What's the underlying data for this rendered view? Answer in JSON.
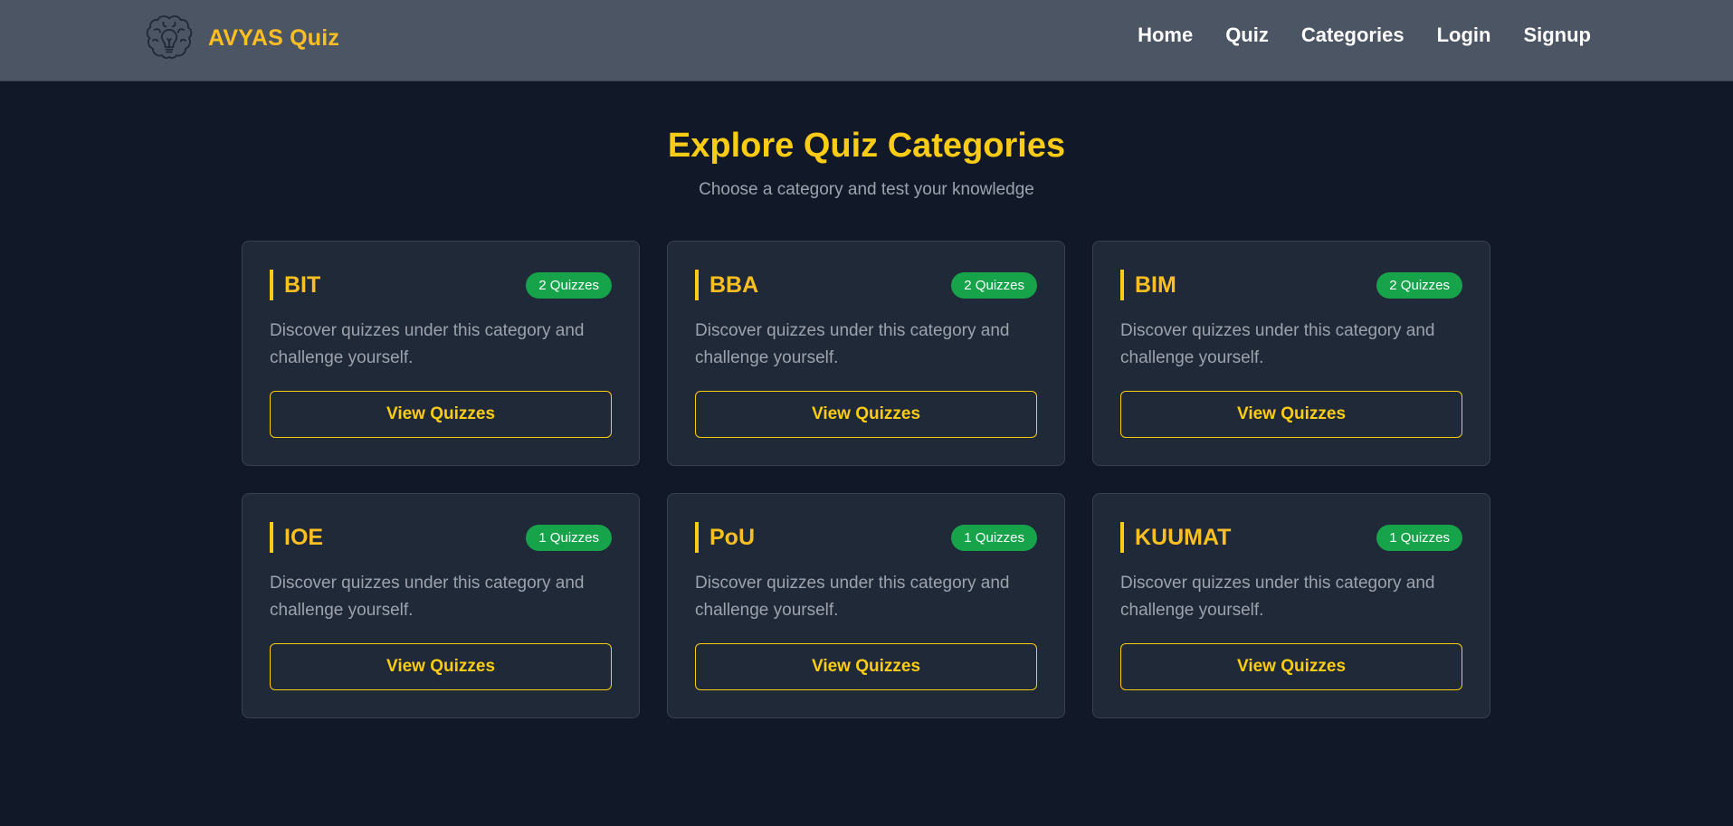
{
  "brand": {
    "name": "AVYAS Quiz",
    "logo_icon": "brain-lightbulb-icon"
  },
  "nav": {
    "links": [
      "Home",
      "Quiz",
      "Categories",
      "Login",
      "Signup"
    ]
  },
  "hero": {
    "title": "Explore Quiz Categories",
    "subtitle": "Choose a category and test your knowledge"
  },
  "categories": [
    {
      "name": "BIT",
      "badge": "2 Quizzes",
      "description": "Discover quizzes under this category and challenge yourself.",
      "button": "View Quizzes"
    },
    {
      "name": "BBA",
      "badge": "2 Quizzes",
      "description": "Discover quizzes under this category and challenge yourself.",
      "button": "View Quizzes"
    },
    {
      "name": "BIM",
      "badge": "2 Quizzes",
      "description": "Discover quizzes under this category and challenge yourself.",
      "button": "View Quizzes"
    },
    {
      "name": "IOE",
      "badge": "1 Quizzes",
      "description": "Discover quizzes under this category and challenge yourself.",
      "button": "View Quizzes"
    },
    {
      "name": "PoU",
      "badge": "1 Quizzes",
      "description": "Discover quizzes under this category and challenge yourself.",
      "button": "View Quizzes"
    },
    {
      "name": "KUUMAT",
      "badge": "1 Quizzes",
      "description": "Discover quizzes under this category and challenge yourself.",
      "button": "View Quizzes"
    }
  ],
  "colors": {
    "page_background": "#111827",
    "navbar_background": "#4b5563",
    "card_background": "#1f2937",
    "accent": "#facc15",
    "badge": "#16a34a",
    "muted_text": "#9ca3af"
  }
}
